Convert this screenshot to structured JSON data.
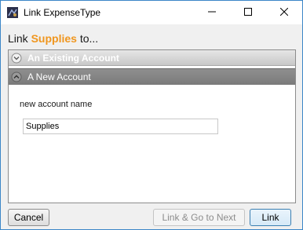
{
  "window": {
    "title": "Link ExpenseType",
    "controls": {
      "minimize_icon": "minimize-icon",
      "maximize_icon": "maximize-icon",
      "close_icon": "close-icon"
    }
  },
  "heading": {
    "prefix": "Link ",
    "item": "Supplies",
    "suffix": " to..."
  },
  "accordion": {
    "existing": {
      "label": "An Existing Account",
      "expanded": false,
      "icon": "chevron-down-circle-icon"
    },
    "new": {
      "label": "A New Account",
      "expanded": true,
      "icon": "chevron-up-circle-icon"
    }
  },
  "form": {
    "field_label": "new account name",
    "account_name_value": "Supplies"
  },
  "buttons": {
    "cancel": "Cancel",
    "link_and_next": "Link & Go to Next",
    "link": "Link"
  },
  "colors": {
    "accent": "#f0961e",
    "window_border": "#3c86c8",
    "default_button_border": "#3c7fb1",
    "header_existing": "#d6d6d6",
    "header_new": "#838383"
  }
}
